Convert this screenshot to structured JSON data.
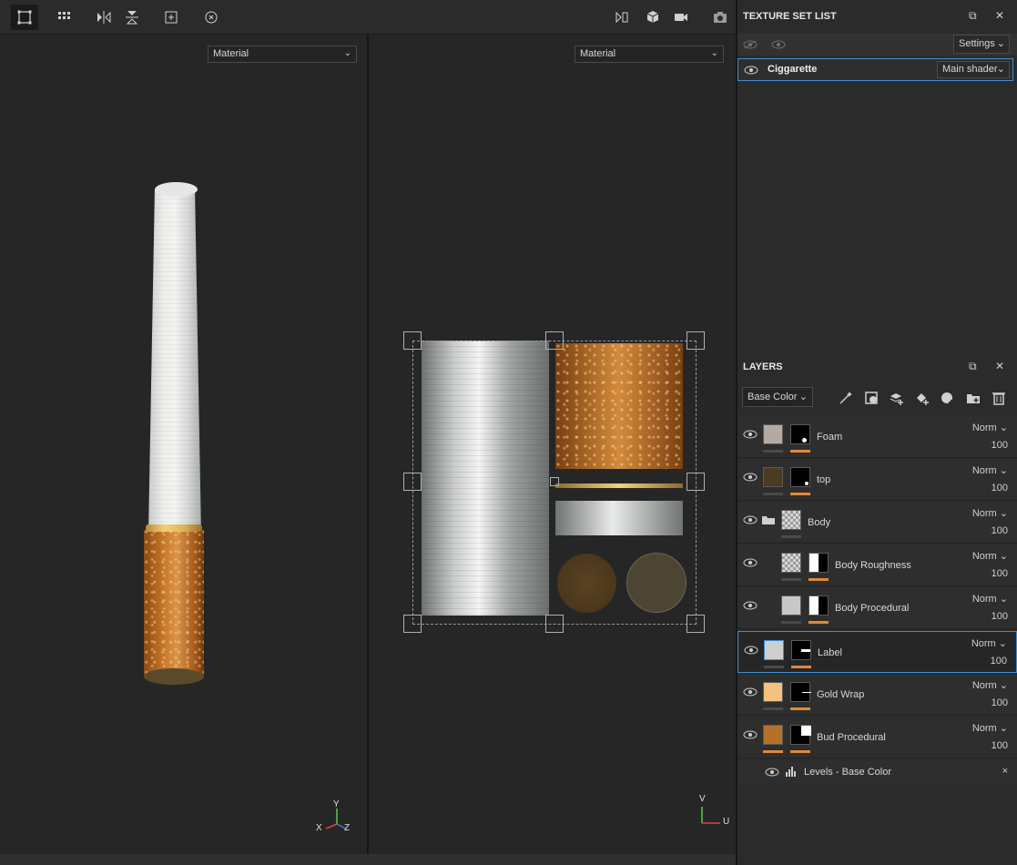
{
  "viewports": {
    "left_material": "Material",
    "right_material": "Material",
    "axis3d": {
      "y": "Y",
      "x": "X",
      "z": "Z"
    },
    "axis2d": {
      "v": "V",
      "u": "U"
    }
  },
  "texture_set": {
    "title": "TEXTURE SET LIST",
    "settings_label": "Settings",
    "row_name": "Ciggarette",
    "shader_label": "Main shader"
  },
  "layers": {
    "title": "LAYERS",
    "channel": "Base Color",
    "items": [
      {
        "name": "Foam",
        "blend": "Norm",
        "opacity": "100"
      },
      {
        "name": "top",
        "blend": "Norm",
        "opacity": "100"
      },
      {
        "name": "Body",
        "blend": "Norm",
        "opacity": "100"
      },
      {
        "name": "Body Roughness",
        "blend": "Norm",
        "opacity": "100"
      },
      {
        "name": "Body Procedural",
        "blend": "Norm",
        "opacity": "100"
      },
      {
        "name": "Label",
        "blend": "Norm",
        "opacity": "100"
      },
      {
        "name": "Gold Wrap",
        "blend": "Norm",
        "opacity": "100"
      },
      {
        "name": "Bud Procedural",
        "blend": "Norm",
        "opacity": "100"
      }
    ],
    "effect": "Levels - Base Color"
  },
  "colors": {
    "accent": "#3c8fd6",
    "mask_orange": "#e08a3a"
  }
}
